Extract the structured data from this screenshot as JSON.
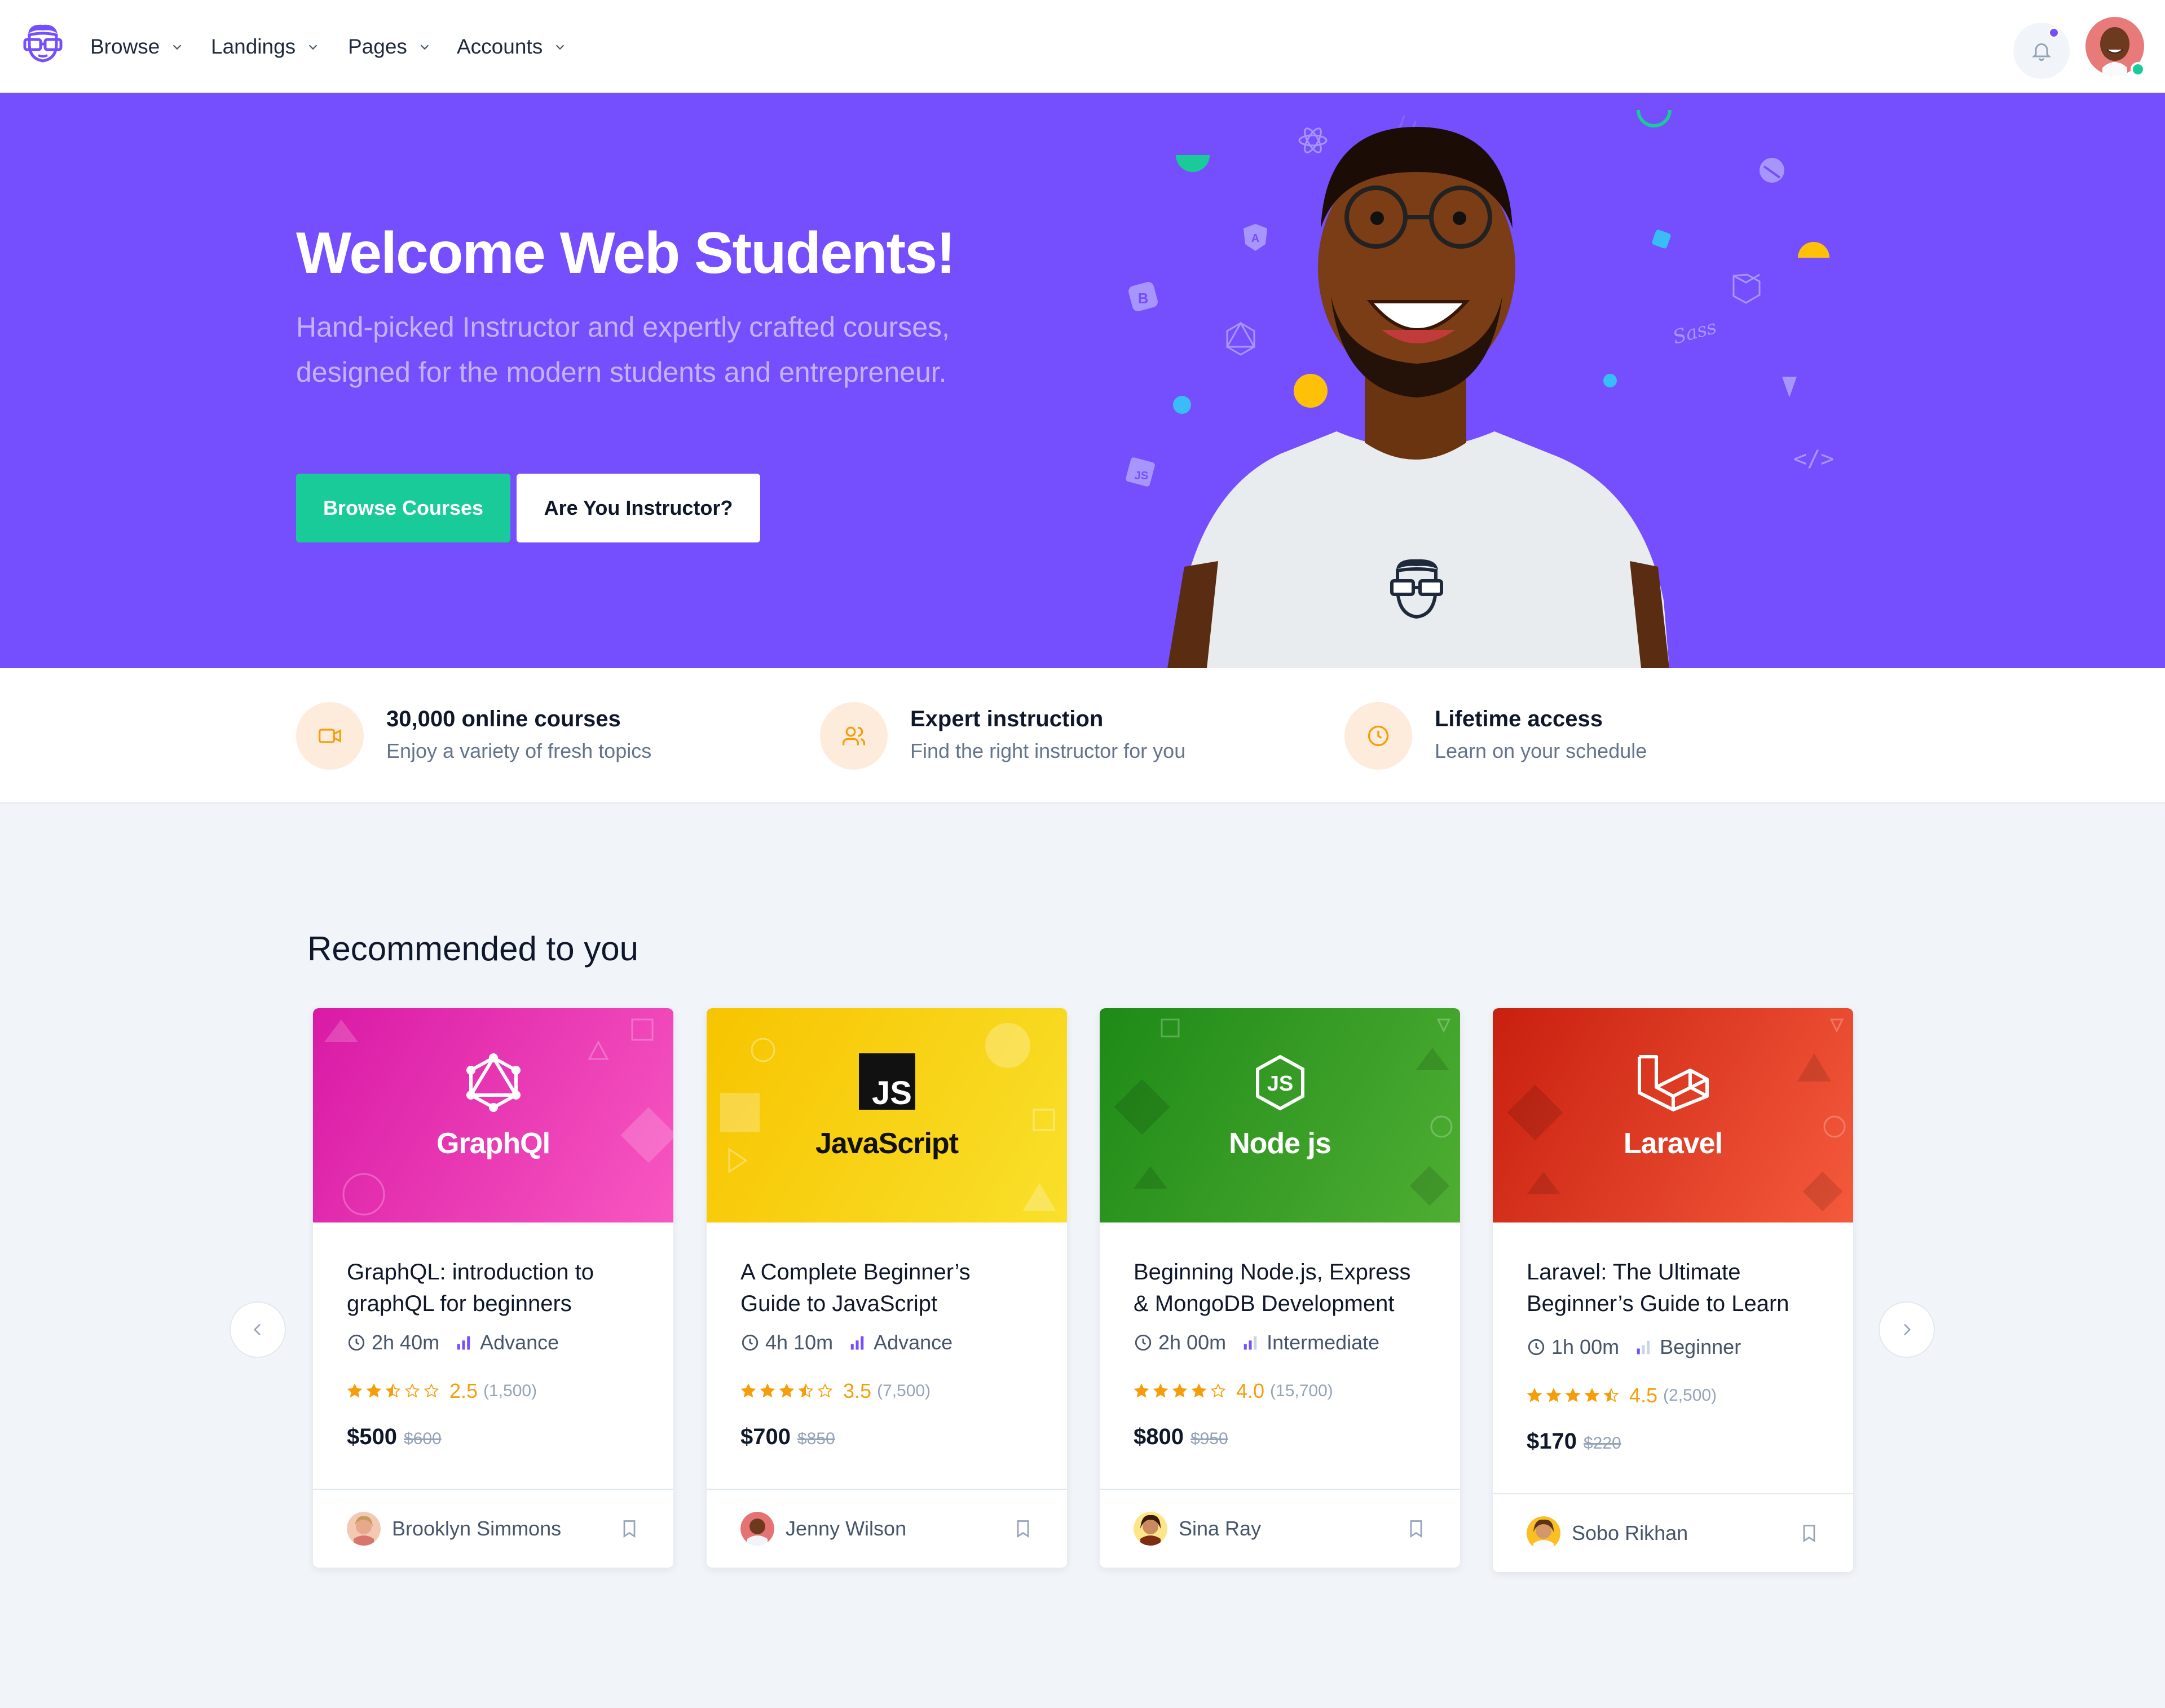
{
  "nav": {
    "items": [
      {
        "label": "Browse"
      },
      {
        "label": "Landings"
      },
      {
        "label": "Pages"
      },
      {
        "label": "Accounts"
      }
    ]
  },
  "hero": {
    "title": "Welcome Web Students!",
    "subtitle": "Hand-picked Instructor and expertly crafted courses, designed for the modern students and entrepreneur.",
    "primary_button": "Browse Courses",
    "secondary_button": "Are You Instructor?",
    "shirt_icon": "geeks-mascot-icon",
    "tech_icons": [
      "angular-icon",
      "react-icon",
      "bootstrap-icon",
      "graphql-icon",
      "js-icon",
      "sass-icon",
      "vue-icon",
      "laravel-icon",
      "code-icon",
      "gatsby-icon"
    ]
  },
  "features": [
    {
      "icon": "video-icon",
      "title": "30,000 online courses",
      "desc": "Enjoy a variety of fresh topics"
    },
    {
      "icon": "users-icon",
      "title": "Expert instruction",
      "desc": "Find the right instructor for you"
    },
    {
      "icon": "clock-icon",
      "title": "Lifetime access",
      "desc": "Learn on your schedule"
    }
  ],
  "section": {
    "title": "Recommended to you"
  },
  "courses": [
    {
      "banner_label": "GraphQl",
      "title": "GraphQL: introduction to graphQL for beginners",
      "duration": "2h 40m",
      "level": "Advance",
      "rating": "2.5",
      "rating_value": 2.5,
      "reviews": "(1,500)",
      "price": "$500",
      "old_price": "$600",
      "author": "Brooklyn Simmons",
      "colors": {
        "from": "#d91aa6",
        "to": "#f857c1",
        "text": "#ffffff"
      }
    },
    {
      "banner_label": "JavaScript",
      "banner_badge": "JS",
      "title": "A Complete Beginner’s Guide to JavaScript",
      "duration": "4h 10m",
      "level": "Advance",
      "rating": "3.5",
      "rating_value": 3.5,
      "reviews": "(7,500)",
      "price": "$700",
      "old_price": "$850",
      "author": "Jenny Wilson",
      "colors": {
        "from": "#f7c400",
        "to": "#f9e02b",
        "text": "#111111"
      }
    },
    {
      "banner_label": "Node js",
      "title": "Beginning Node.js, Express & MongoDB Development",
      "duration": "2h 00m",
      "level": "Intermediate",
      "rating": "4.0",
      "rating_value": 4.0,
      "reviews": "(15,700)",
      "price": "$800",
      "old_price": "$950",
      "author": "Sina Ray",
      "colors": {
        "from": "#1e8a17",
        "to": "#4fae33",
        "text": "#ffffff"
      }
    },
    {
      "banner_label": "Laravel",
      "title": "Laravel: The Ultimate Beginner’s Guide to Learn",
      "duration": "1h 00m",
      "level": "Beginner",
      "rating": "4.5",
      "rating_value": 4.5,
      "reviews": "(2,500)",
      "price": "$170",
      "old_price": "$220",
      "author": "Sobo Rikhan",
      "colors": {
        "from": "#c8200f",
        "to": "#f55a3c",
        "text": "#ffffff"
      }
    }
  ],
  "theme": {
    "primary": "#754ffe",
    "success": "#19cb98",
    "star": "#f59e0b"
  }
}
